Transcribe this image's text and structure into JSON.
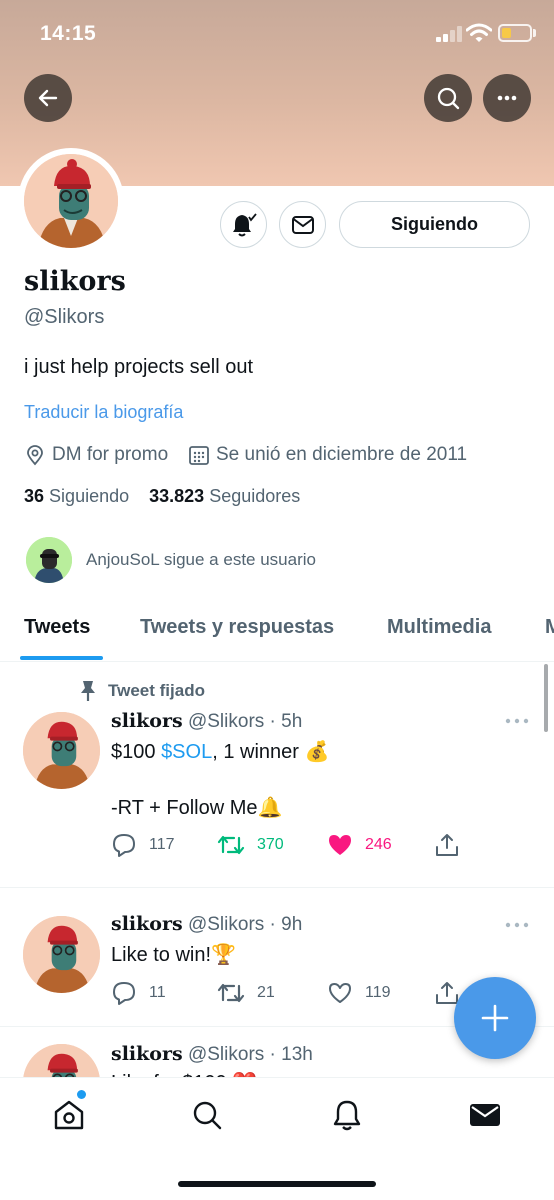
{
  "status_bar": {
    "time": "14:15"
  },
  "header": {
    "back_icon": "arrow-left-icon",
    "search_icon": "search-icon",
    "more_icon": "more-horizontal-icon"
  },
  "profile": {
    "name": "slikors",
    "handle": "@Slikors",
    "bio": "i just help projects sell out",
    "translate_link": "Traducir la biografía",
    "location": "DM for promo",
    "joined": "Se unió en diciembre de 2011",
    "following_count": "36",
    "following_label": "Siguiendo",
    "followers_count": "33.823",
    "followers_label": "Seguidores",
    "follow_button": "Siguiendo",
    "followed_by": "AnjouSoL sigue a este usuario"
  },
  "tabs": [
    "Tweets",
    "Tweets y respuestas",
    "Multimedia",
    "M"
  ],
  "tweets": [
    {
      "pinned_label": "Tweet fijado",
      "name": "slikors",
      "handle_time": "@Slikors · 5h",
      "text_prefix": "$100 ",
      "cashtag": "$SOL",
      "text_suffix": ", 1 winner 💰",
      "text_line2": "-RT + Follow Me🔔",
      "replies": "117",
      "retweets": "370",
      "likes": "246"
    },
    {
      "name": "slikors",
      "handle_time": "@Slikors · 9h",
      "text": "Like to win!🏆",
      "replies": "11",
      "retweets": "21",
      "likes": "119"
    },
    {
      "name": "slikors",
      "handle_time": "@Slikors · 13h",
      "text": "Like for $100 ❤️"
    }
  ],
  "colors": {
    "accent": "#1d9bf0",
    "retweet_green": "#00ba7c",
    "like_pink": "#f91880",
    "secondary_text": "#536471"
  }
}
